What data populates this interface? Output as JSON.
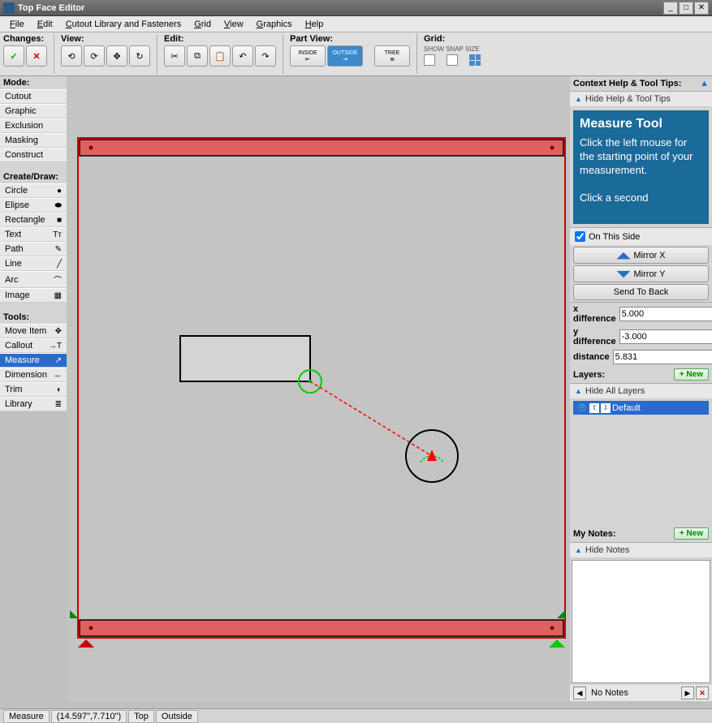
{
  "title": "Top Face Editor",
  "menu": [
    "File",
    "Edit",
    "Cutout Library and Fasteners",
    "Grid",
    "View",
    "Graphics",
    "Help"
  ],
  "toolbar": {
    "changes": "Changes:",
    "view": "View:",
    "edit": "Edit:",
    "partview": "Part View:",
    "inside": "INSIDE",
    "outside": "OUTSIDE",
    "tree": "TREE",
    "grid": "Grid:",
    "grid_sub": "SHOW SNAP   SIZE"
  },
  "leftpanel": {
    "mode_hdr": "Mode:",
    "modes": [
      "Cutout",
      "Graphic",
      "Exclusion",
      "Masking",
      "Construct"
    ],
    "create_hdr": "Create/Draw:",
    "create": [
      "Circle",
      "Elipse",
      "Rectangle",
      "Text",
      "Path",
      "Line",
      "Arc",
      "Image"
    ],
    "tools_hdr": "Tools:",
    "tools": [
      "Move Item",
      "Callout",
      "Measure",
      "Dimension",
      "Trim",
      "Library"
    ]
  },
  "rightpanel": {
    "context_hdr": "Context Help & Tool Tips:",
    "hide_tips": "Hide Help & Tool Tips",
    "tooltip_title": "Measure Tool",
    "tooltip_body": "Click the left mouse for the starting point of your measurement.",
    "tooltip_body2": "Click a second",
    "on_this_side": "On This Side",
    "mirror_x": "Mirror X",
    "mirror_y": "Mirror Y",
    "send_back": "Send To Back",
    "xdiff_label": "x difference",
    "xdiff": "5.000",
    "ydiff_label": "y difference",
    "ydiff": "-3.000",
    "dist_label": "distance",
    "dist": "5.831",
    "layers_hdr": "Layers:",
    "new_btn": "+ New",
    "hide_layers": "Hide All Layers",
    "layer_default": "Default",
    "notes_hdr": "My Notes:",
    "hide_notes": "Hide Notes",
    "no_notes": "No Notes"
  },
  "status": {
    "tool": "Measure",
    "coords": "(14.597\",7.710\")",
    "face": "Top",
    "side": "Outside"
  }
}
